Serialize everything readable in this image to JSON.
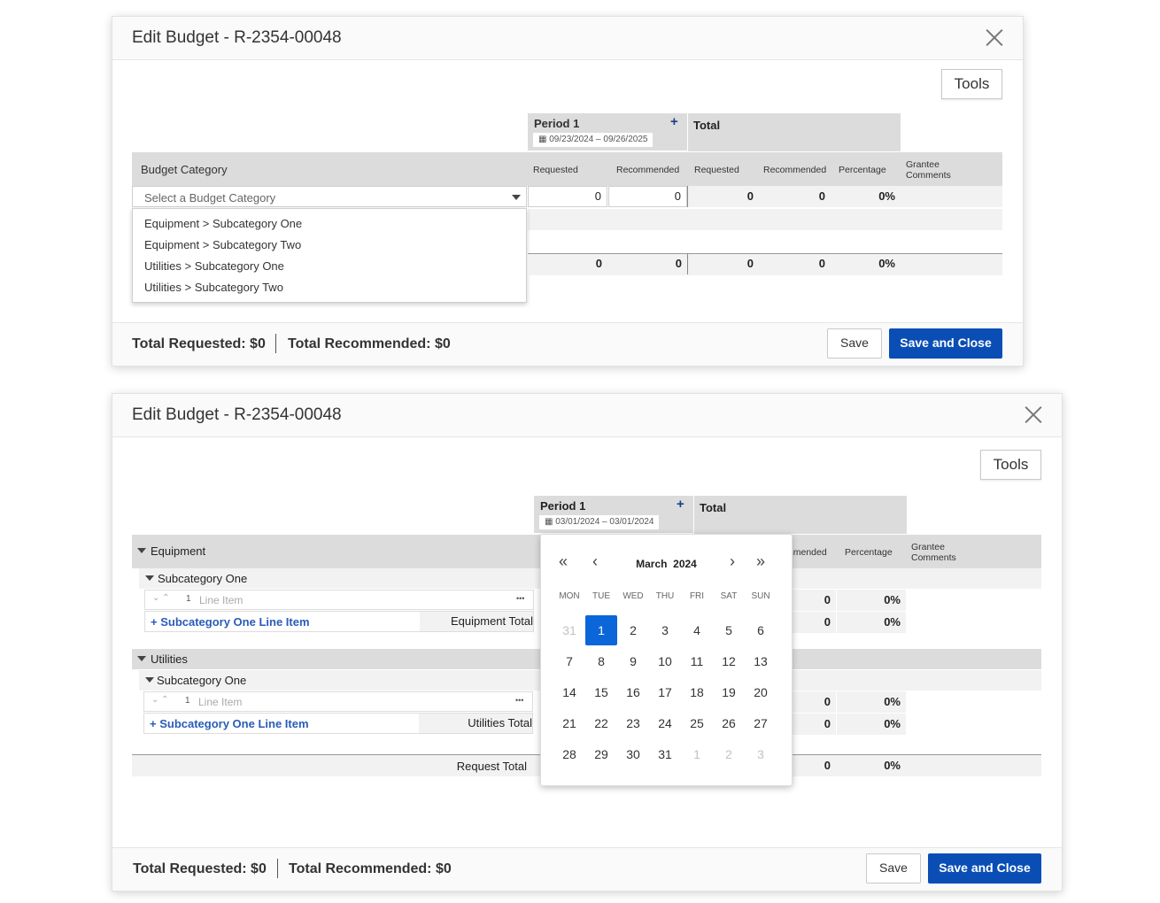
{
  "top": {
    "title": "Edit Budget - R-2354-00048",
    "tools_label": "Tools",
    "period": {
      "label": "Period 1",
      "plus": "+",
      "date_range": "09/23/2024 – 09/26/2025"
    },
    "total_label": "Total",
    "budget_category_label": "Budget Category",
    "col_requested": "Requested",
    "col_recommended": "Recommended",
    "col_total_requested": "Requested",
    "col_total_recommended": "Recommended",
    "col_percentage": "Percentage",
    "col_grantee": "Grantee",
    "col_comments": "Comments",
    "select_placeholder": "Select a Budget Category",
    "row1": {
      "requested": "0",
      "recommended": "0",
      "t_requested": "0",
      "t_recommended": "0",
      "percentage": "0%"
    },
    "dropdown_options": [
      "Equipment > Subcategory One",
      "Equipment > Subcategory Two",
      "Utilities > Subcategory One",
      "Utilities > Subcategory Two"
    ],
    "total_row": {
      "requested": "0",
      "recommended": "0",
      "t_requested": "0",
      "t_recommended": "0",
      "percentage": "0%"
    },
    "footer": {
      "total_requested": "Total Requested: $0",
      "total_recommended": "Total Recommended: $0",
      "save": "Save",
      "save_close": "Save and Close"
    }
  },
  "bottom": {
    "title": "Edit Budget - R-2354-00048",
    "tools_label": "Tools",
    "period": {
      "label": "Period 1",
      "plus": "+",
      "date_range": "03/01/2024 – 03/01/2024"
    },
    "total_label": "Total",
    "col_recommended_partial": "mmended",
    "col_percentage": "Percentage",
    "col_grantee": "Grantee",
    "col_comments": "Comments",
    "groups": [
      {
        "name": "Equipment",
        "sub": "Subcategory One",
        "line_no": "1",
        "line_item": "Line Item",
        "ellipsis": "•••",
        "add_link": "+ Subcategory One Line Item",
        "total_label": "Equipment Total",
        "line_values": {
          "t_recommended": "0",
          "percentage": "0%"
        },
        "total_values": {
          "t_recommended": "0",
          "percentage": "0%"
        }
      },
      {
        "name": "Utilities",
        "sub": "Subcategory One",
        "line_no": "1",
        "line_item": "Line Item",
        "ellipsis": "•••",
        "add_link": "+ Subcategory One Line Item",
        "total_label": "Utilities Total",
        "line_values": {
          "t_recommended": "0",
          "percentage": "0%"
        },
        "total_values": {
          "t_recommended": "0",
          "percentage": "0%"
        }
      }
    ],
    "request_total": {
      "label": "Request Total",
      "t_recommended": "0",
      "percentage": "0%"
    },
    "calendar": {
      "month_year": "March  2024",
      "dow": [
        "MON",
        "TUE",
        "WED",
        "THU",
        "FRI",
        "SAT",
        "SUN"
      ],
      "weeks": [
        [
          "31",
          "1",
          "2",
          "3",
          "4",
          "5",
          "6"
        ],
        [
          "7",
          "8",
          "9",
          "10",
          "11",
          "12",
          "13"
        ],
        [
          "14",
          "15",
          "16",
          "17",
          "18",
          "19",
          "20"
        ],
        [
          "21",
          "22",
          "23",
          "24",
          "25",
          "26",
          "27"
        ],
        [
          "28",
          "29",
          "30",
          "31",
          "1",
          "2",
          "3"
        ]
      ],
      "selected": "1"
    },
    "footer": {
      "total_requested": "Total Requested: $0",
      "total_recommended": "Total Recommended: $0",
      "save": "Save",
      "save_close": "Save and Close"
    }
  }
}
